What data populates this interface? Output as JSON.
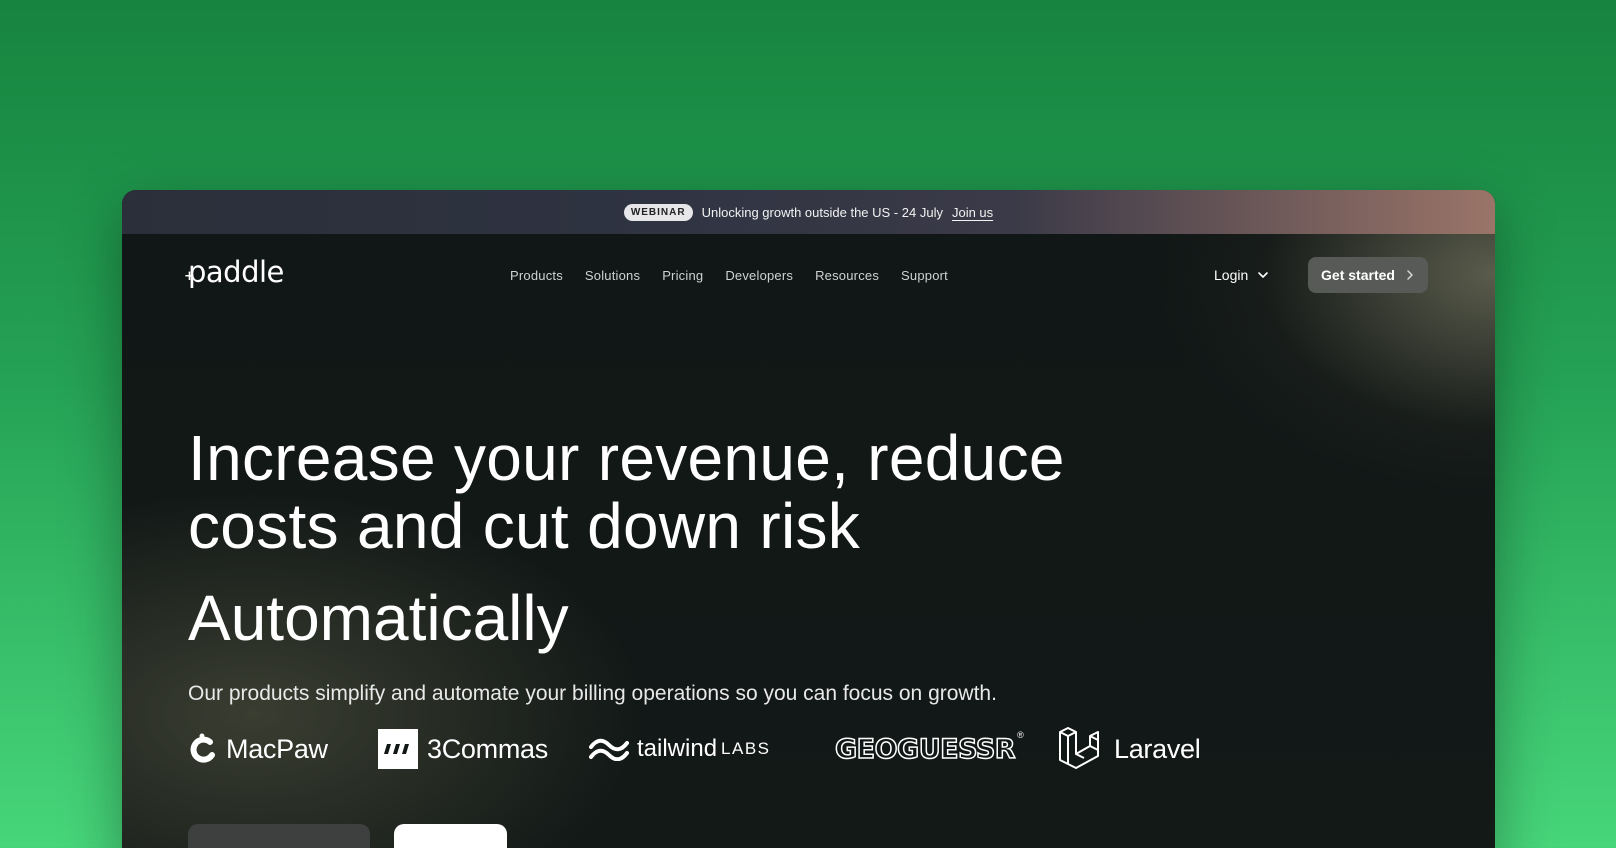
{
  "banner": {
    "badge": "WEBINAR",
    "text": "Unlocking growth outside the US - 24 July",
    "link": "Join us"
  },
  "nav": {
    "logo": "paddle",
    "links": [
      "Products",
      "Solutions",
      "Pricing",
      "Developers",
      "Resources",
      "Support"
    ],
    "login": "Login",
    "cta": "Get started"
  },
  "hero": {
    "headline": "Increase your revenue, reduce costs and cut down risk",
    "subheadline": "Automatically",
    "description": "Our products simplify and automate your billing operations so you can focus on growth."
  },
  "customer_logos": [
    {
      "name": "MacPaw",
      "icon": "macpaw-logo"
    },
    {
      "name": "3Commas",
      "icon": "3commas-logo"
    },
    {
      "name": "tailwind",
      "suffix": "LABS",
      "icon": "tailwind-logo"
    },
    {
      "name": "GEOGUESSR",
      "icon": "geoguessr-logo"
    },
    {
      "name": "Laravel",
      "icon": "laravel-logo"
    }
  ],
  "colors": {
    "background": "#25a255",
    "window": "#111716",
    "cta_bg": "#575a57"
  }
}
